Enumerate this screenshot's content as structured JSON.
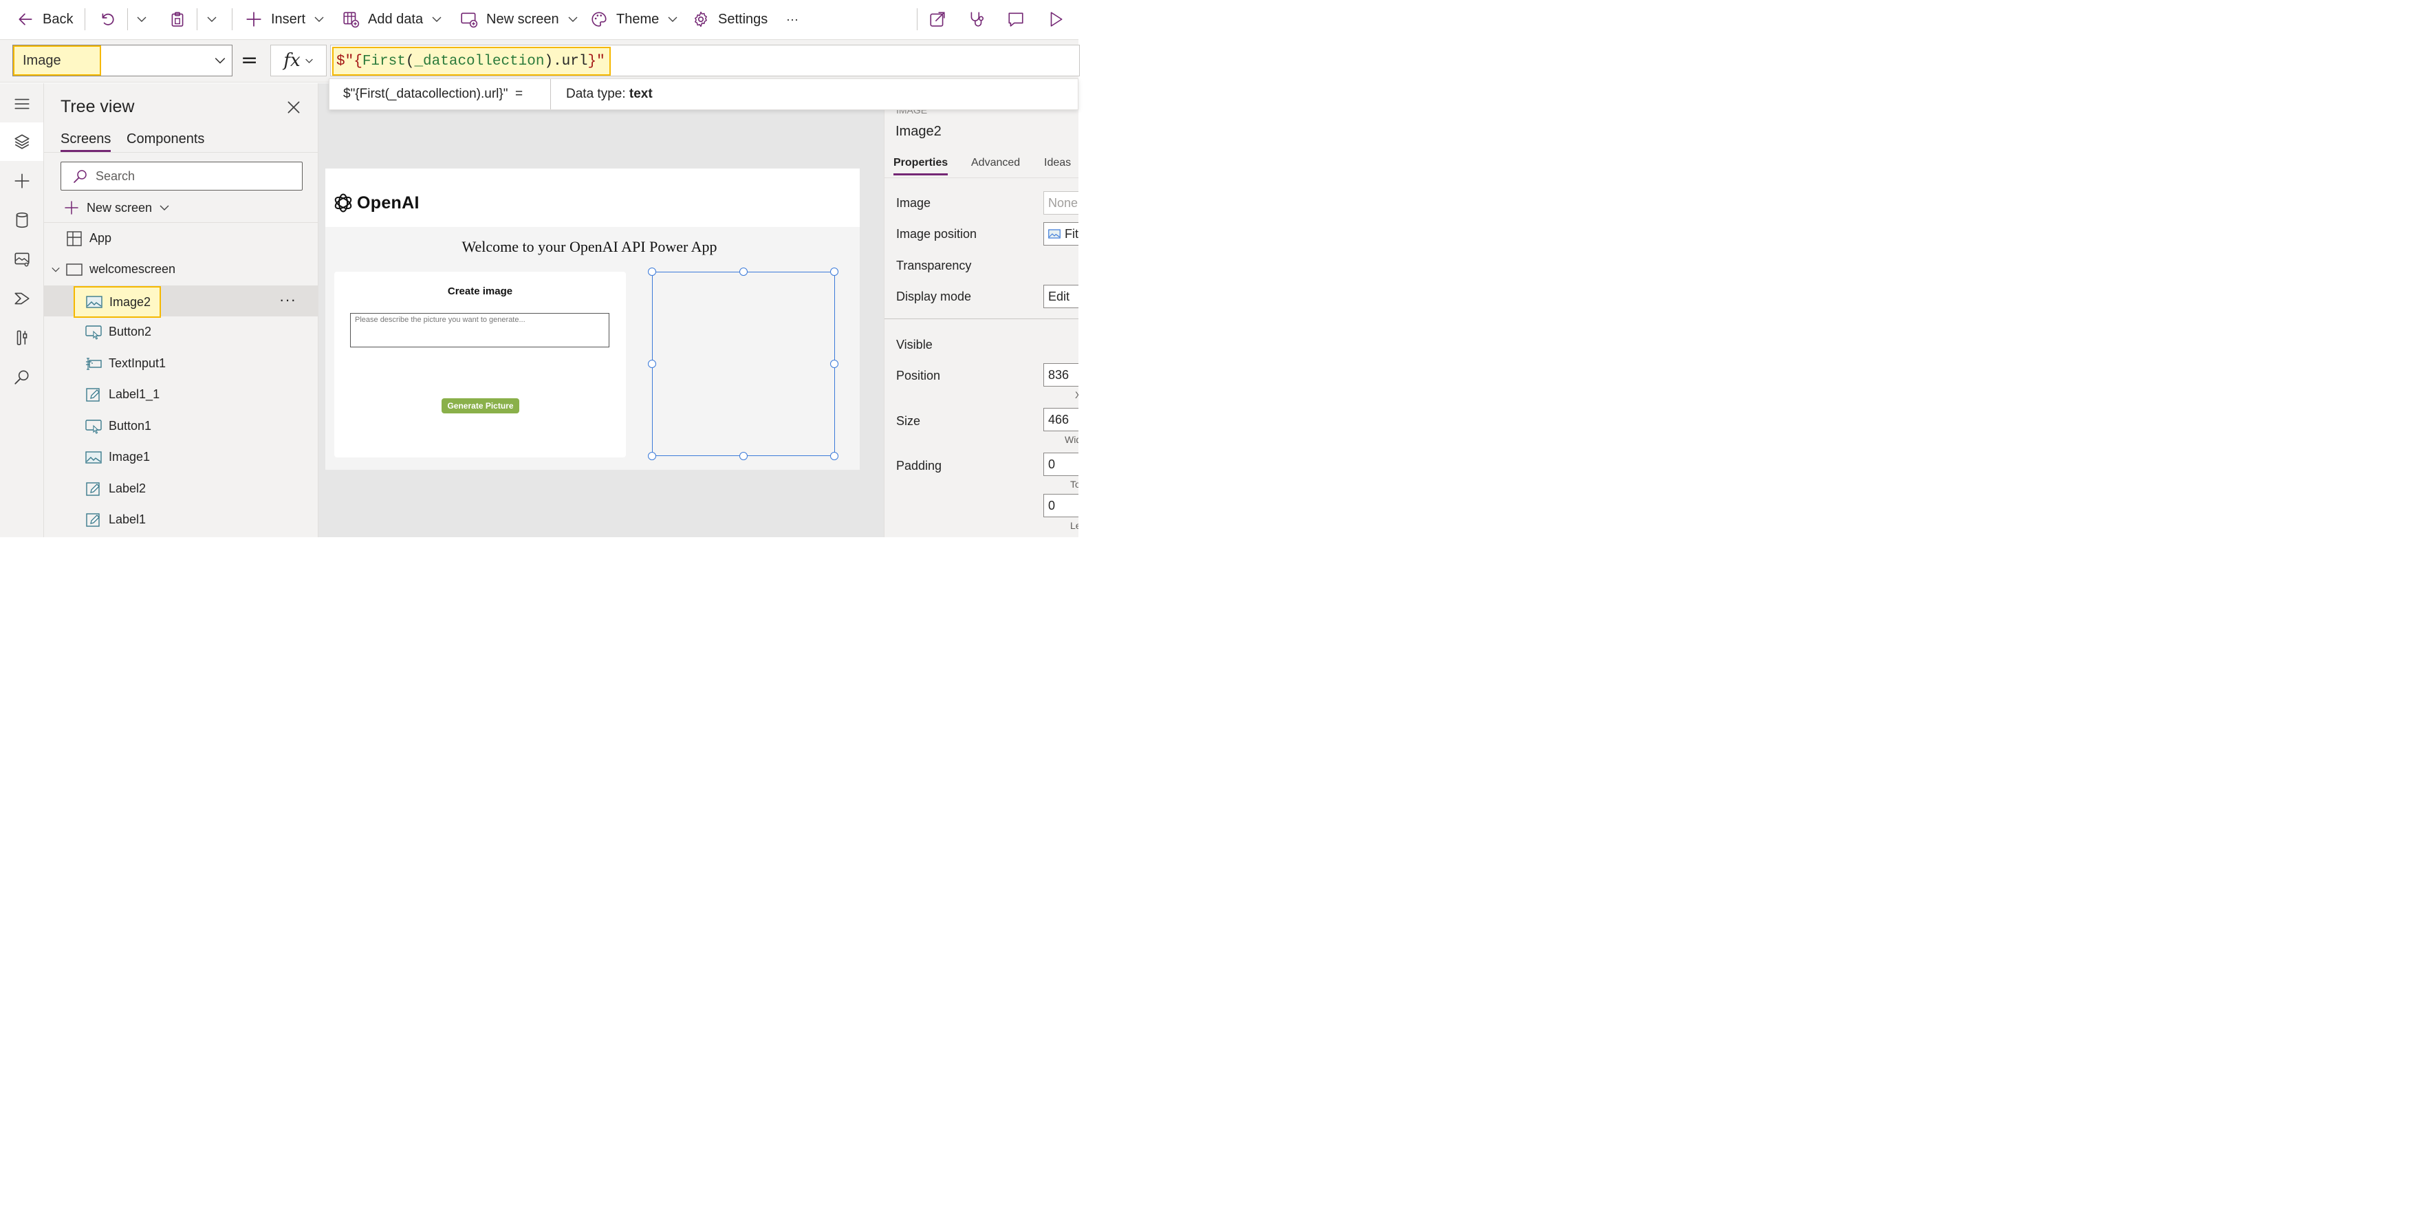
{
  "toolbar": {
    "back_label": "Back",
    "insert_label": "Insert",
    "add_data_label": "Add data",
    "new_screen_label": "New screen",
    "theme_label": "Theme",
    "settings_label": "Settings",
    "more_label": "···"
  },
  "formula_bar": {
    "property": "Image",
    "equals": "=",
    "fx_label": "fx",
    "formula_tokens": {
      "t1": "$\"{",
      "t2": "First",
      "t3": "(",
      "t4": "_datacollection",
      "t5": ").url",
      "t6": "}\""
    },
    "result_expression": "$\"{First(_datacollection).url}\"  =",
    "data_type_label": "Data type: ",
    "data_type_value": "text"
  },
  "left_rail": {
    "items": [
      "menu-icon",
      "layers-icon",
      "plus-icon",
      "database-icon",
      "media-icon",
      "power-automate-icon",
      "advanced-tools-icon",
      "search-icon"
    ],
    "active": "layers-icon"
  },
  "tree_view": {
    "title": "Tree view",
    "tabs": [
      "Screens",
      "Components"
    ],
    "search_placeholder": "Search",
    "new_screen_label": "New screen",
    "app_label": "App",
    "screen_name": "welcomescreen",
    "controls": [
      {
        "name": "Image2",
        "icon": "image-icon",
        "selected": true
      },
      {
        "name": "Button2",
        "icon": "button-icon"
      },
      {
        "name": "TextInput1",
        "icon": "text-input-icon"
      },
      {
        "name": "Label1_1",
        "icon": "label-icon"
      },
      {
        "name": "Button1",
        "icon": "button-icon"
      },
      {
        "name": "Image1",
        "icon": "image-icon"
      },
      {
        "name": "Label2",
        "icon": "label-icon"
      },
      {
        "name": "Label1",
        "icon": "label-icon"
      }
    ],
    "more_label": "···"
  },
  "canvas": {
    "brand": "OpenAI",
    "welcome_text": "Welcome to your OpenAI API Power App",
    "card_title": "Create image",
    "prompt_placeholder": "Please describe the picture you want to generate...",
    "generate_button": "Generate Picture"
  },
  "properties_panel": {
    "control_kind": "IMAGE",
    "control_name": "Image2",
    "tabs": [
      "Properties",
      "Advanced",
      "Ideas"
    ],
    "rows": {
      "image": {
        "label": "Image",
        "value": "None"
      },
      "image_position": {
        "label": "Image position",
        "value": "Fit"
      },
      "transparency": {
        "label": "Transparency"
      },
      "display_mode": {
        "label": "Display mode",
        "value": "Edit"
      },
      "visible": {
        "label": "Visible"
      },
      "position": {
        "label": "Position",
        "value": "836",
        "sub": "X"
      },
      "size": {
        "label": "Size",
        "value": "466",
        "sub": "Width"
      },
      "padding": {
        "label": "Padding",
        "value_top": "0",
        "sub_top": "Top",
        "value_left": "0",
        "sub_left": "Left"
      }
    }
  },
  "colors": {
    "accent": "#742774",
    "highlight_fill": "#fff8c5",
    "highlight_border": "#f5b800",
    "selection_blue": "#3b7ad9",
    "generate_button": "#8ab04a"
  }
}
